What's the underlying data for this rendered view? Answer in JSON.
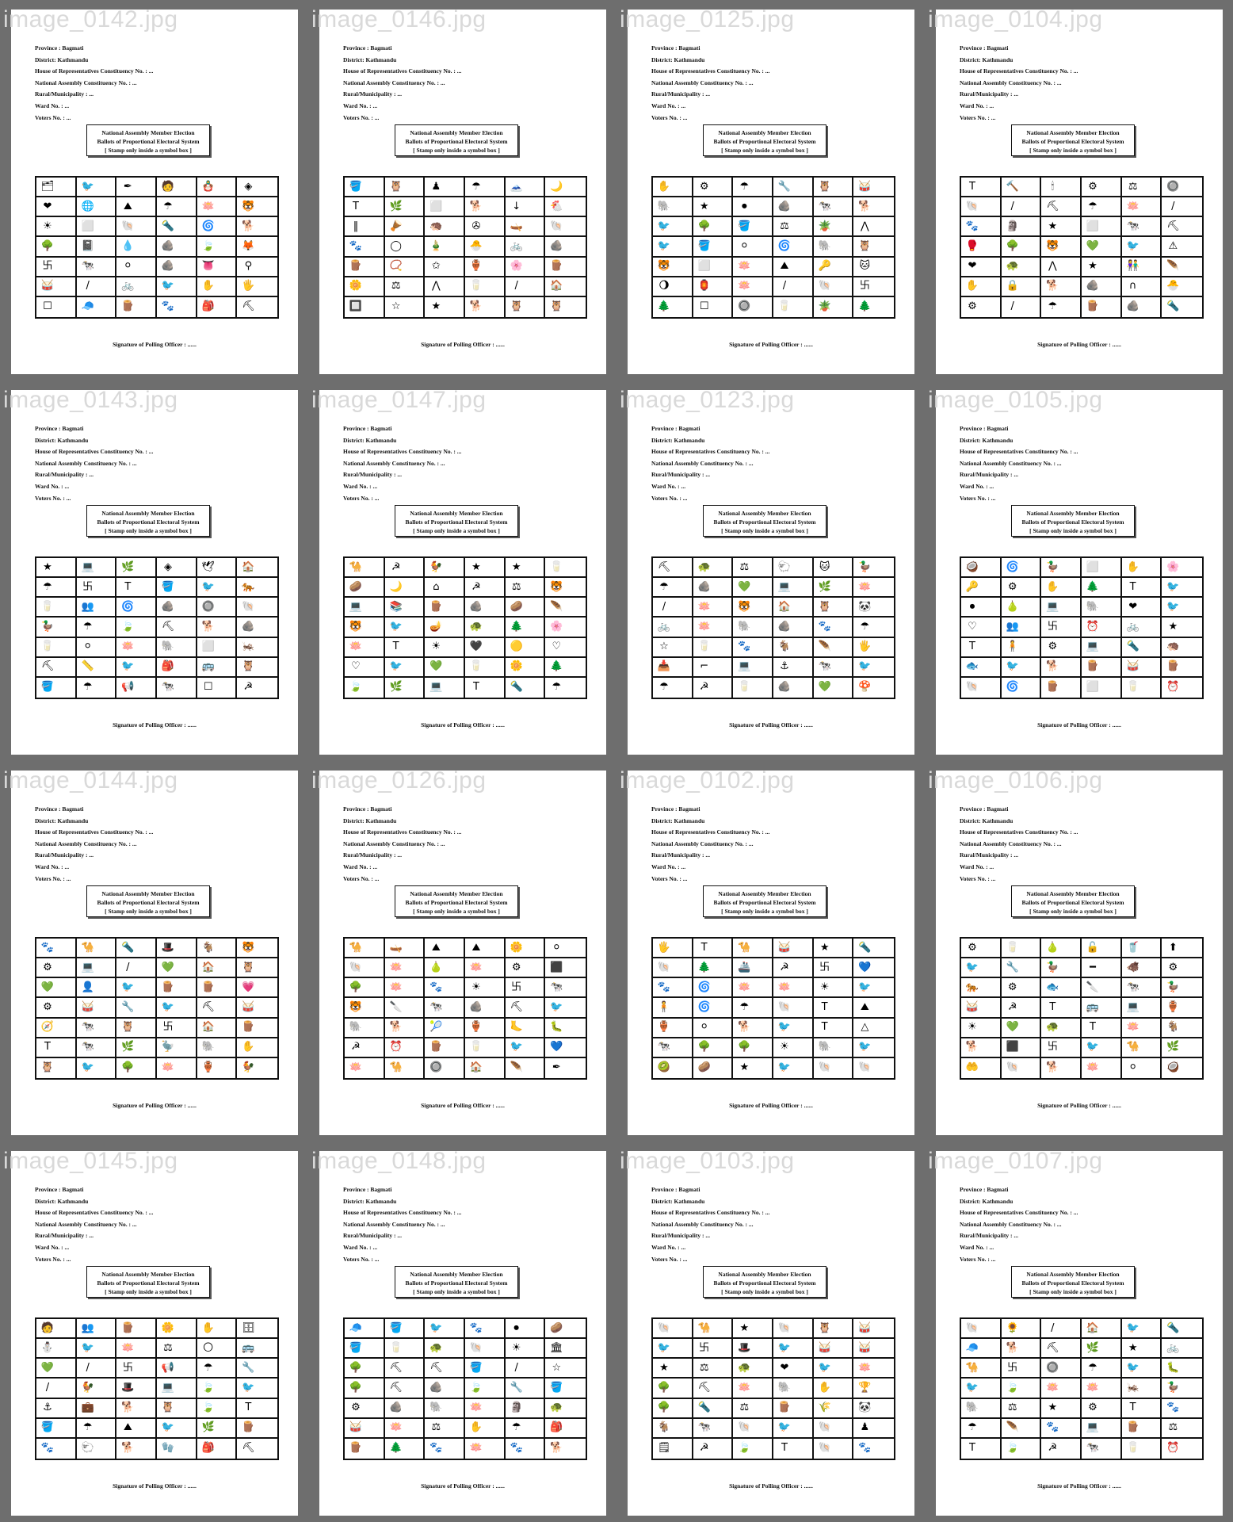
{
  "ballot_text": {
    "province": "Province : Bagmati",
    "district": "District: Kathmandu",
    "hor_constituency": "House of Representatives Constituency No. : ...",
    "na_constituency": "National Assembly Constituency No. : ...",
    "municipality": "Rural/Municipality : ...",
    "ward": "Ward No. : ...",
    "voters": "Voters No. : ...",
    "title_line1": "National Assembly Member Election",
    "title_line2": "Ballots of Proportional Electoral System",
    "title_line3": "[ Stamp only inside a symbol box ]",
    "signature": "Signature of Polling Officer : ......"
  },
  "images": [
    {
      "filename": "image_0142.jpg",
      "symbols": [
        "🗂",
        "🐦",
        "✒",
        "🧑",
        "🪆",
        "◈",
        "❤",
        "🌐",
        "⛰",
        "☂",
        "🪷",
        "🐯",
        "☀",
        "⬜",
        "🐚",
        "🔦",
        "🌀",
        "🐕",
        "🌳",
        "📓",
        "💧",
        "🪨",
        "🍃",
        "🦊",
        "卐",
        "🐄",
        "⚪",
        "🪨",
        "👅",
        "⚲",
        "🥁",
        "/",
        "🚲",
        "🐦",
        "✋",
        "🖐",
        "☐",
        "🧢",
        "🪵",
        "🐾",
        "🎒",
        "⛏"
      ]
    },
    {
      "filename": "image_0146.jpg",
      "symbols": [
        "🪣",
        "🦉",
        "♟",
        "☂",
        "🗻",
        "🌙",
        "T",
        "🌿",
        "⬜",
        "🐕",
        "↓",
        "🐔",
        "‖",
        "🪘",
        "🦔",
        "✇",
        "🛶",
        "🐚",
        "🐾",
        "◯",
        "🎍",
        "🐣",
        "🚲",
        "🪨",
        "🪵",
        "📿",
        "✩",
        "🏺",
        "🌸",
        "🪵",
        "🌼",
        "⚖",
        "⋀",
        "🥛",
        "/",
        "🏠",
        "🔲",
        "☆",
        "★",
        "🐕",
        "🦉",
        "🦉"
      ]
    },
    {
      "filename": "image_0125.jpg",
      "symbols": [
        "✋",
        "⚙",
        "☂",
        "🔧",
        "🦉",
        "🥁",
        "🐘",
        "★",
        "⏺",
        "🪨",
        "🐄",
        "🐕",
        "🐦",
        "🌳",
        "🪣",
        "⚖",
        "🪴",
        "⋀",
        "🐦",
        "🪣",
        "⚪",
        "🌀",
        "🐘",
        "🦉",
        "🐯",
        "⬜",
        "🪷",
        "⛰",
        "🔑",
        "🐱",
        "🌖",
        "🏮",
        "🪷",
        "/",
        "🐚",
        "卐",
        "🌲",
        "☐",
        "🔘",
        "🥛",
        "🪴",
        "🌲"
      ]
    },
    {
      "filename": "image_0104.jpg",
      "symbols": [
        "T",
        "🔨",
        "🕯",
        "⚙",
        "⚖",
        "🔘",
        "🐚",
        "/",
        "⛏",
        "☂",
        "🪷",
        "/",
        "🐾",
        "🗿",
        "★",
        "⬜",
        "🐄",
        "⛏",
        "🥊",
        "🌳",
        "🐯",
        "💚",
        "🐦",
        "⚠",
        "❤",
        "🐢",
        "⋀",
        "★",
        "👫",
        "🪶",
        "✋",
        "🔒",
        "🐕",
        "🪨",
        "∩",
        "🐣",
        "⚙",
        "/",
        "☂",
        "🪵",
        "🪨",
        "🔦"
      ]
    },
    {
      "filename": "image_0143.jpg",
      "symbols": [
        "★",
        "💻",
        "🌿",
        "◈",
        "🕊",
        "🏠",
        "☂",
        "卐",
        "T",
        "🪣",
        "🐦",
        "🐅",
        "🥛",
        "👥",
        "🌀",
        "🪨",
        "🔘",
        "🐚",
        "🦆",
        "☂",
        "🍃",
        "⛏",
        "🐕",
        "🪨",
        "🥛",
        "⚪",
        "🪷",
        "🐘",
        "⬜",
        "🦗",
        "⛏",
        "📏",
        "🐦",
        "🎒",
        "🚌",
        "🦉",
        "🪣",
        "☂",
        "📢",
        "🐄",
        "☐",
        "☭"
      ]
    },
    {
      "filename": "image_0147.jpg",
      "symbols": [
        "🐪",
        "☭",
        "🐓",
        "★",
        "★",
        "🥛",
        "🥔",
        "🌙",
        "⌂",
        "☭",
        "⚖",
        "🐯",
        "💻",
        "📚",
        "🪵",
        "🪨",
        "🥔",
        "🪶",
        "🐯",
        "🐦",
        "🪔",
        "🐢",
        "🌲",
        "🌸",
        "🪷",
        "T",
        "☀",
        "🖤",
        "🟡",
        "♡",
        "♡",
        "🐦",
        "💚",
        "🥛",
        "🌼",
        "🌲",
        "🍃",
        "🌿",
        "💻",
        "T",
        "🔦",
        "☂"
      ]
    },
    {
      "filename": "image_0123.jpg",
      "symbols": [
        "⛏",
        "🐢",
        "⚖",
        "🐑",
        "🐱",
        "🦆",
        "☂",
        "🪨",
        "💚",
        "💻",
        "🌿",
        "🪷",
        "/",
        "🪷",
        "🐯",
        "🏠",
        "🦉",
        "🐼",
        "🚲",
        "🪷",
        "🐘",
        "🪨",
        "🐾",
        "☂",
        "☆",
        "🥛",
        "🐾",
        "🐐",
        "🪶",
        "🖐",
        "📥",
        "⌐",
        "💻",
        "⚓",
        "🐄",
        "🐦",
        "☂",
        "☭",
        "🥛",
        "🪨",
        "💚",
        "🍄"
      ]
    },
    {
      "filename": "image_0105.jpg",
      "symbols": [
        "🥥",
        "🌀",
        "🦆",
        "⬜",
        "✋",
        "🌸",
        "🔑",
        "⚙",
        "✋",
        "🌲",
        "T",
        "🐦",
        "⏺",
        "🍐",
        "💻",
        "🐘",
        "❤",
        "🐦",
        "♡",
        "👥",
        "卐",
        "⏰",
        "🚲",
        "★",
        "T",
        "🧍",
        "⚙",
        "💻",
        "🔦",
        "🦔",
        "🐟",
        "🐦",
        "🐕",
        "🪵",
        "🥁",
        "🪵",
        "🐚",
        "🌀",
        "🪵",
        "⬜",
        "🥛",
        "⏰"
      ]
    },
    {
      "filename": "image_0144.jpg",
      "symbols": [
        "🐾",
        "🐪",
        "🔦",
        "🎩",
        "🐐",
        "🐯",
        "⚙",
        "💻",
        "/",
        "💚",
        "🏠",
        "🦉",
        "💚",
        "👤",
        "🐦",
        "🪵",
        "🪵",
        "💗",
        "⚙",
        "🥁",
        "🔧",
        "🐦",
        "⛏",
        "🥁",
        "🧭",
        "🐄",
        "🦉",
        "卐",
        "🏠",
        "🪵",
        "T",
        "🐄",
        "🌿",
        "🦤",
        "🐘",
        "✋",
        "🦉",
        "🐦",
        "🌳",
        "🪷",
        "🏺",
        "🐓"
      ]
    },
    {
      "filename": "image_0126.jpg",
      "symbols": [
        "🐪",
        "🛶",
        "⛰",
        "⛰",
        "🌼",
        "⚪",
        "🐚",
        "🪷",
        "🍐",
        "🪷",
        "⚙",
        "⬛",
        "🌳",
        "🪷",
        "🐾",
        "☀",
        "卐",
        "🐄",
        "🐯",
        "🔪",
        "🐄",
        "🪨",
        "⛏",
        "🐦",
        "🐘",
        "🐕",
        "🎾",
        "🏺",
        "🦶",
        "🐛",
        "☭",
        "⏰",
        "🪵",
        "🥛",
        "🐦",
        "💙",
        "🪷",
        "🐪",
        "🔘",
        "🏠",
        "🪶",
        "✒"
      ]
    },
    {
      "filename": "image_0102.jpg",
      "symbols": [
        "🖐",
        "T",
        "🐪",
        "🥁",
        "★",
        "🔦",
        "🐚",
        "🌲",
        "🚢",
        "☭",
        "卐",
        "💙",
        "🐾",
        "🌀",
        "🪷",
        "🪷",
        "☀",
        "🐦",
        "🧍",
        "🌀",
        "☂",
        "🐚",
        "T",
        "⛰",
        "🏺",
        "⚪",
        "🐕",
        "🐦",
        "T",
        "△",
        "🐄",
        "🌳",
        "🌳",
        "☀",
        "🐘",
        "🐦",
        "🥝",
        "🥔",
        "★",
        "🐦",
        "🐚",
        "🐚"
      ]
    },
    {
      "filename": "image_0106.jpg",
      "symbols": [
        "⚙",
        "🥛",
        "🍐",
        "🔓",
        "🥤",
        "⬆",
        "🐦",
        "🔧",
        "🦆",
        "━",
        "🐗",
        "⚙",
        "🐅",
        "⚙",
        "🐟",
        "🔪",
        "🐄",
        "🦆",
        "🥁",
        "☭",
        "T",
        "🚌",
        "💻",
        "🏺",
        "☀",
        "💚",
        "🐢",
        "T",
        "🪷",
        "🐐",
        "🐕",
        "⬛",
        "卐",
        "🐦",
        "🐪",
        "🌿",
        "🤲",
        "🐚",
        "🐕",
        "🪷",
        "⚪",
        "🥥"
      ]
    },
    {
      "filename": "image_0145.jpg",
      "symbols": [
        "🧑",
        "👥",
        "🪵",
        "🌼",
        "✋",
        "🗄",
        "⛄",
        "🐦",
        "🪷",
        "⚖",
        "🌕",
        "🚌",
        "💚",
        "/",
        "卐",
        "📢",
        "☂",
        "🔧",
        "/",
        "🐓",
        "🎩",
        "💻",
        "🍃",
        "🐦",
        "⚓",
        "💼",
        "🐕",
        "🦉",
        "🍃",
        "T",
        "🪣",
        "☂",
        "⛰",
        "🐦",
        "🌿",
        "🪵",
        "🐾",
        "🐑",
        "🐕",
        "🧤",
        "🎒",
        "⛏"
      ]
    },
    {
      "filename": "image_0148.jpg",
      "symbols": [
        "🧢",
        "🪣",
        "🐦",
        "🐾",
        "⏺",
        "🥔",
        "🪣",
        "🥛",
        "🐢",
        "🐚",
        "☀",
        "🏛",
        "🌳",
        "⛏",
        "⛏",
        "🪣",
        "/",
        "☆",
        "🌳",
        "⛏",
        "🪨",
        "🍃",
        "🔧",
        "🪣",
        "⚙",
        "🪨",
        "🐘",
        "🪷",
        "🗿",
        "🐢",
        "🥁",
        "🪷",
        "⚖",
        "✋",
        "☂",
        "🎒",
        "🪵",
        "🌲",
        "🐾",
        "🪷",
        "🐾",
        "🐕"
      ]
    },
    {
      "filename": "image_0103.jpg",
      "symbols": [
        "🐚",
        "🐪",
        "★",
        "🐚",
        "🦉",
        "🥁",
        "🐦",
        "卐",
        "🎩",
        "🐦",
        "🥁",
        "🥁",
        "★",
        "⚖",
        "🐢",
        "❤",
        "🐦",
        "🪷",
        "🌳",
        "⛏",
        "🪷",
        "🐘",
        "✋",
        "🏆",
        "🌳",
        "🔦",
        "⚖",
        "🪵",
        "🌾",
        "🐼",
        "🐐",
        "🐄",
        "🐚",
        "🐦",
        "🐚",
        "♟",
        "🗒",
        "☭",
        "🍃",
        "T",
        "🐚",
        "🐾"
      ]
    },
    {
      "filename": "image_0107.jpg",
      "symbols": [
        "🐚",
        "🌻",
        "/",
        "🏠",
        "🐦",
        "🔦",
        "🧢",
        "🐕",
        "⛏",
        "🌿",
        "★",
        "🚲",
        "🐪",
        "卐",
        "🔘",
        "☂",
        "🐦",
        "🐛",
        "🐦",
        "🍃",
        "🪷",
        "🪷",
        "🦗",
        "🦆",
        "🐘",
        "⚖",
        "★",
        "⚙",
        "T",
        "🐾",
        "☂",
        "🪶",
        "🐾",
        "💻",
        "🪵",
        "⚖",
        "T",
        "🍃",
        "☭",
        "🐄",
        "🥛",
        "⏰"
      ]
    }
  ],
  "colors": {
    "background": "#6e6e6e",
    "page": "#ffffff",
    "filename": "#d9d9d9",
    "ink": "#111111"
  }
}
